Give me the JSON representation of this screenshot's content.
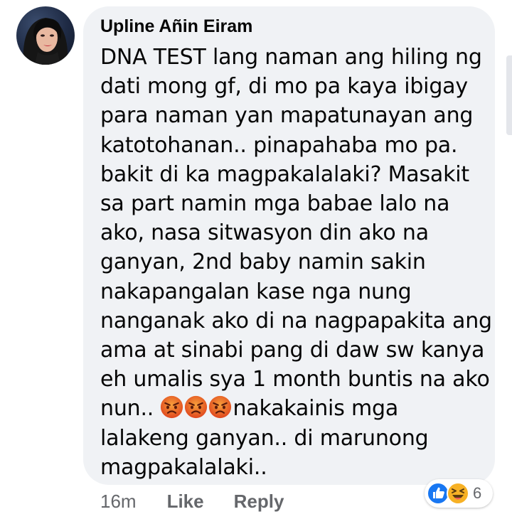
{
  "comment": {
    "author": "Upline Añin Eiram",
    "lines": [
      "DNA TEST lang naman ang hiling ng",
      "dati mong gf, di mo pa kaya ibigay",
      "para naman yan mapatunayan ang",
      "katotohanan.. pinapahaba mo pa.",
      "bakit  di ka magpakalalaki? Masakit",
      "sa part namin mga babae lalo na",
      "ako, nasa sitwasyon din ako na",
      "ganyan, 2nd baby namin sakin",
      "nakapangalan kase nga nung",
      "nanganak ako di na nagpapakita ang",
      "ama at sinabi pang di daw sw kanya",
      "eh umalis sya 1 month buntis na ako"
    ],
    "line_with_emoji_before": "nun.. ",
    "line_with_emoji_after": "nakakainis mga",
    "emoji_name": "angry-face-emoji",
    "lines_after": [
      "lalakeng ganyan.. di marunong",
      "magpakalalaki.."
    ]
  },
  "actions": {
    "time": "16m",
    "like_label": "Like",
    "reply_label": "Reply"
  },
  "reactions": {
    "icons": [
      "like-reaction-icon",
      "haha-reaction-icon"
    ],
    "count": "6"
  },
  "colors": {
    "bubble": "#f0f2f5",
    "text": "#050505",
    "secondary_text": "#65676b",
    "like_blue": "#1877f2",
    "haha_yellow": "#f7b125"
  }
}
